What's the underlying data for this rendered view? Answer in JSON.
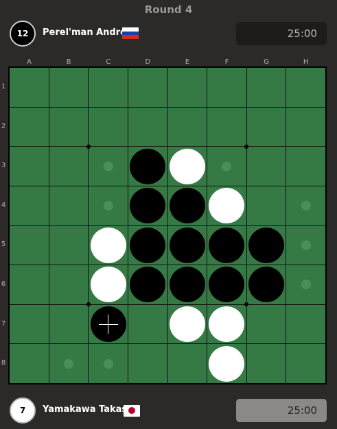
{
  "round_title": "Round 4",
  "top_player": {
    "name": "Perel'man Andrey",
    "disc_count": "12",
    "disc_color": "black",
    "flag": "russia-flag",
    "flag_colors": [
      "#ffffff",
      "#1c3fa8",
      "#d52b1e"
    ],
    "clock": "25:00"
  },
  "bottom_player": {
    "name": "Yamakawa Takashi",
    "disc_count": "7",
    "disc_color": "white",
    "flag": "japan-flag",
    "flag_colors": [
      "#ffffff",
      "#bc002d"
    ],
    "clock": "25:00"
  },
  "board": {
    "columns": [
      "A",
      "B",
      "C",
      "D",
      "E",
      "F",
      "G",
      "H"
    ],
    "rows": [
      "1",
      "2",
      "3",
      "4",
      "5",
      "6",
      "7",
      "8"
    ],
    "colors": {
      "felt": "#357a44",
      "hint": "#4c8d5b",
      "lines": "#111111"
    },
    "cells": [
      "........",
      "........",
      "..hBWh..",
      "..hBBW.h",
      "..WBBBBh",
      "..WBBBBh",
      "..B.WW..",
      ".hh..W.."
    ],
    "last_move": "C7"
  }
}
